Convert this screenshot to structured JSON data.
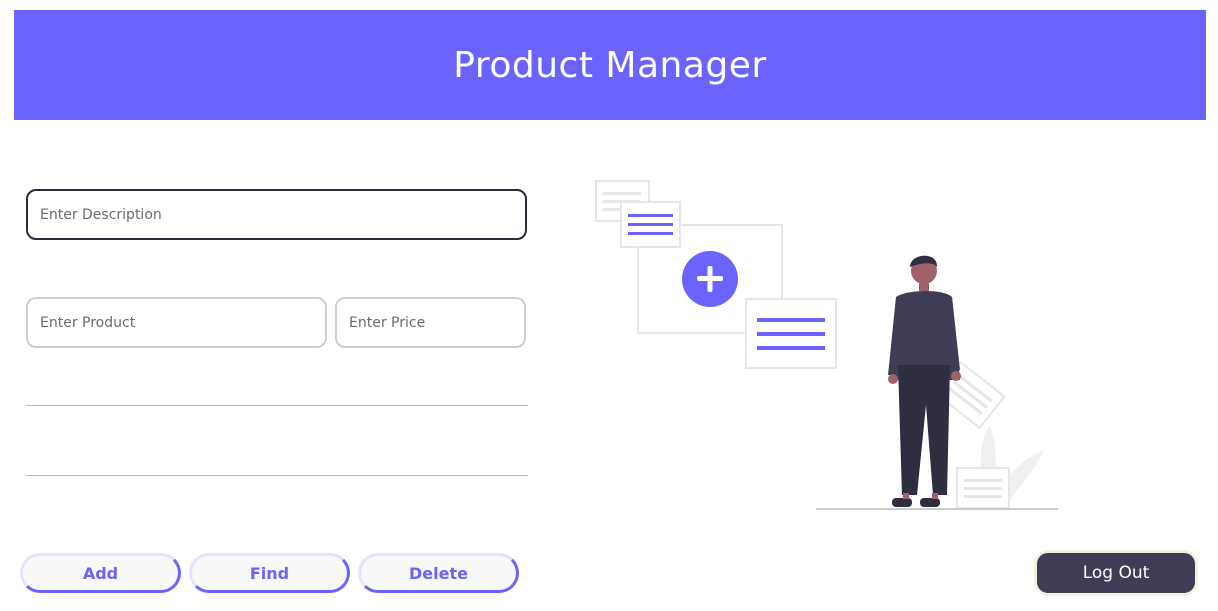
{
  "header": {
    "title": "Product Manager"
  },
  "form": {
    "description": {
      "value": "",
      "placeholder": "Enter Description"
    },
    "product": {
      "value": "",
      "placeholder": "Enter Product"
    },
    "price": {
      "value": "",
      "placeholder": "Enter Price"
    }
  },
  "actions": {
    "add_label": "Add",
    "find_label": "Find",
    "delete_label": "Delete",
    "logout_label": "Log Out"
  },
  "colors": {
    "accent": "#6c63ff",
    "dark": "#3f3d56"
  },
  "icons": {
    "illustration": "add-product-illustration",
    "plus": "plus-circle-icon"
  }
}
